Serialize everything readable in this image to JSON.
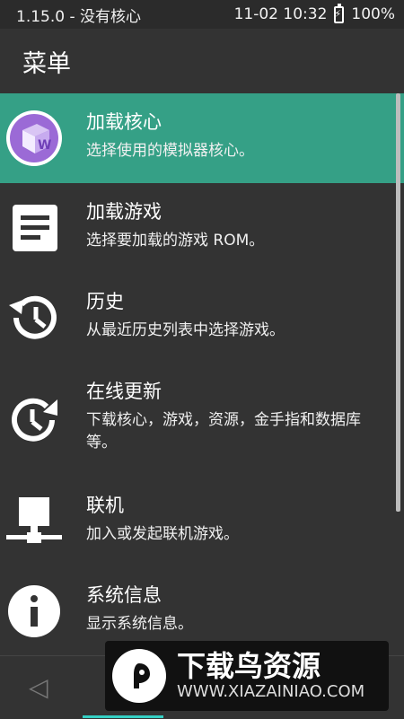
{
  "status_bar": {
    "left_text": "1.15.0 - 没有核心",
    "datetime": "11-02 10:32",
    "battery": "100%"
  },
  "header": {
    "title": "菜单"
  },
  "menu_items": [
    {
      "title": "加载核心",
      "description": "选择使用的模拟器核心。",
      "icon": "core-cube-icon",
      "active": true
    },
    {
      "title": "加载游戏",
      "description": "选择要加载的游戏 ROM。",
      "icon": "document-icon",
      "active": false
    },
    {
      "title": "历史",
      "description": "从最近历史列表中选择游戏。",
      "icon": "history-icon",
      "active": false
    },
    {
      "title": "在线更新",
      "description": "下载核心，游戏，资源，金手指和数据库等。",
      "icon": "update-icon",
      "active": false
    },
    {
      "title": "联机",
      "description": "加入或发起联机游戏。",
      "icon": "network-icon",
      "active": false
    },
    {
      "title": "系统信息",
      "description": "显示系统信息。",
      "icon": "info-icon",
      "active": false
    }
  ],
  "nav": {
    "back_icon": "back-triangle-icon"
  },
  "watermark": {
    "title": "下载鸟资源",
    "url": "WWW.XIAZAINIAO.COM"
  },
  "colors": {
    "accent": "#35a086",
    "background": "#333333",
    "indicator": "#35d0c4"
  }
}
